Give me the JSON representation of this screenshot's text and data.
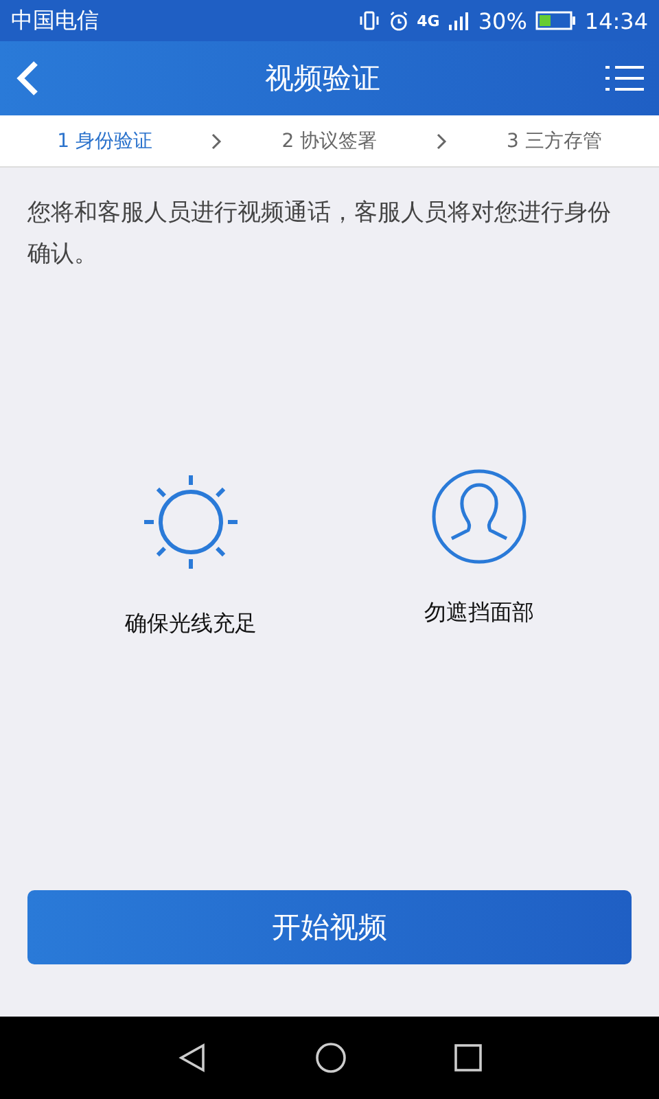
{
  "status_bar": {
    "carrier": "中国电信",
    "network": "4G",
    "battery": "30%",
    "time": "14:34"
  },
  "header": {
    "title": "视频验证"
  },
  "steps": [
    {
      "label": "1 身份验证",
      "selected": true
    },
    {
      "label": "2 协议签署",
      "selected": false
    },
    {
      "label": "3 三方存管",
      "selected": false
    }
  ],
  "intro": "您将和客服人员进行视频通话，客服人员将对您进行身份确认。",
  "tips": [
    {
      "kind": "light",
      "label": "确保光线充足"
    },
    {
      "kind": "face",
      "label": "勿遮挡面部"
    }
  ],
  "start_button": "开始视频"
}
